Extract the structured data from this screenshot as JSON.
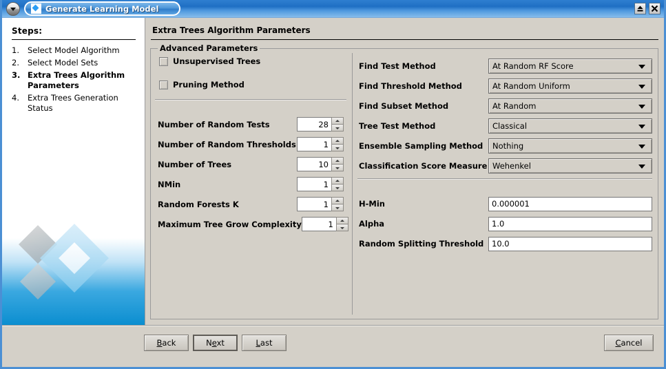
{
  "window": {
    "title": "Generate Learning Model",
    "menu_icon": "chevron-down-icon",
    "app_icon": "diamond-icon",
    "restore_label": "",
    "close_label": ""
  },
  "sidebar": {
    "heading": "Steps:",
    "steps": [
      {
        "num": "1.",
        "label": "Select Model Algorithm",
        "current": false
      },
      {
        "num": "2.",
        "label": "Select Model Sets",
        "current": false
      },
      {
        "num": "3.",
        "label": "Extra Trees Algorithm Parameters",
        "current": true
      },
      {
        "num": "4.",
        "label": "Extra Trees Generation Status",
        "current": false
      }
    ]
  },
  "pane": {
    "title": "Extra Trees Algorithm Parameters",
    "group_title": "Advanced Parameters",
    "checkboxes": [
      {
        "label": "Unsupervised Trees",
        "checked": false
      },
      {
        "label": "Pruning Method",
        "checked": false
      }
    ],
    "spinners": [
      {
        "label": "Number of Random Tests",
        "value": "28"
      },
      {
        "label": "Number of Random Thresholds",
        "value": "1"
      },
      {
        "label": "Number of Trees",
        "value": "10"
      },
      {
        "label": "NMin",
        "value": "1"
      },
      {
        "label": "Random Forests K",
        "value": "1"
      },
      {
        "label": "Maximum Tree Grow Complexity",
        "value": "1"
      }
    ],
    "combos": [
      {
        "label": "Find Test Method",
        "value": "At Random RF Score"
      },
      {
        "label": "Find Threshold Method",
        "value": "At Random Uniform"
      },
      {
        "label": "Find Subset Method",
        "value": "At Random"
      },
      {
        "label": "Tree Test Method",
        "value": "Classical"
      },
      {
        "label": "Ensemble Sampling Method",
        "value": "Nothing"
      },
      {
        "label": "Classification Score Measure",
        "value": "Wehenkel"
      }
    ],
    "textfields": [
      {
        "label": "H-Min",
        "value": "0.000001"
      },
      {
        "label": "Alpha",
        "value": "1.0"
      },
      {
        "label": "Random Splitting Threshold",
        "value": "10.0"
      }
    ]
  },
  "buttons": {
    "back": {
      "pre": "B",
      "mn": "B",
      "post": "ack",
      "text": "Back",
      "default": false
    },
    "next": {
      "pre": "N",
      "mn": "e",
      "post": "xt",
      "text": "Next",
      "default": true
    },
    "last": {
      "pre": "",
      "mn": "L",
      "post": "ast",
      "text": "Last",
      "default": false
    },
    "cancel": {
      "pre": "",
      "mn": "C",
      "post": "ancel",
      "text": "Cancel",
      "default": false
    }
  },
  "colors": {
    "titlebar_blue": "#2f7fd0",
    "frame_blue": "#4b8fd4",
    "panel_gray": "#d4d0c8",
    "accent_cyan": "#2a9df4"
  }
}
